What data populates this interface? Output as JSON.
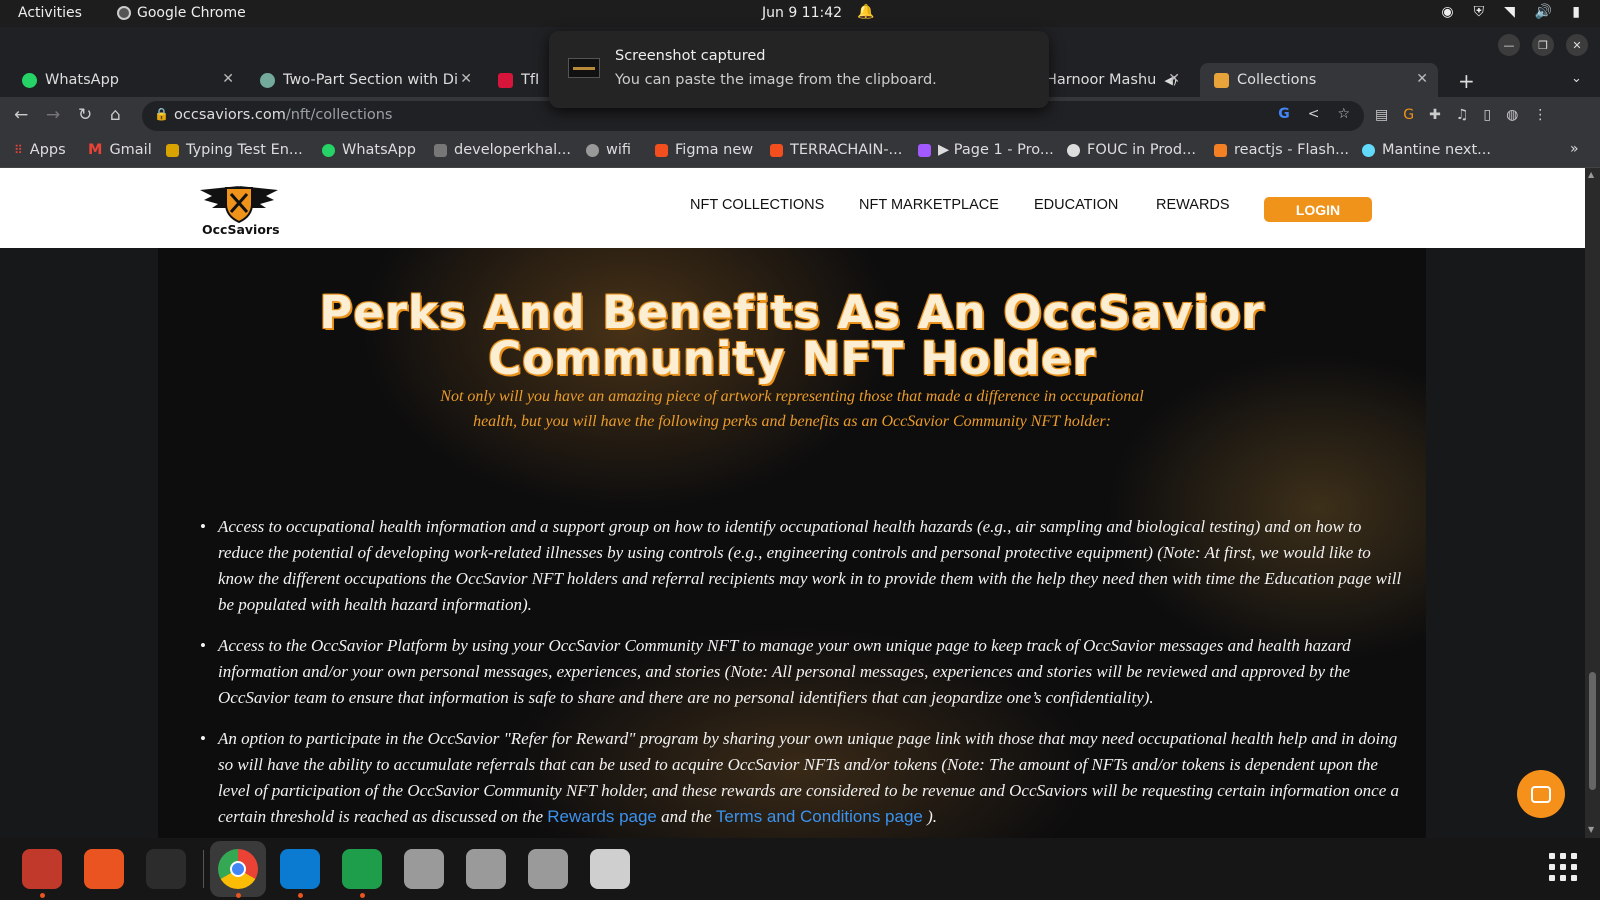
{
  "system_bar": {
    "activities": "Activities",
    "app_name": "Google Chrome",
    "datetime": "Jun 9  11:42"
  },
  "notification": {
    "title": "Screenshot captured",
    "body": "You can paste the image from the clipboard."
  },
  "tabs": [
    {
      "label": "WhatsApp",
      "icon": "whatsapp-icon",
      "color": "#25d366"
    },
    {
      "label": "Two-Part Section with Div",
      "icon": "chatgpt-icon",
      "color": "#74aa9c"
    },
    {
      "label": "TfN",
      "icon": "nsw-icon",
      "color": "#d7153a"
    },
    {
      "label": "Harnoor Mashu",
      "icon": "audio-icon",
      "color": "#888888"
    },
    {
      "label": "Collections",
      "icon": "occsaviors-icon",
      "color": "#e8a33a"
    }
  ],
  "address_bar": {
    "domain": "occsaviors.com",
    "path": "/nft/collections"
  },
  "bookmarks": [
    {
      "label": "Apps",
      "color": "#ea4335"
    },
    {
      "label": "Gmail",
      "color": "#ea4335"
    },
    {
      "label": "Typing Test En...",
      "color": "#d9a400"
    },
    {
      "label": "WhatsApp",
      "color": "#25d366"
    },
    {
      "label": "developerkhal...",
      "color": "#777777"
    },
    {
      "label": "wifi",
      "color": "#999999"
    },
    {
      "label": "Figma new",
      "color": "#f24e1e"
    },
    {
      "label": "TERRACHAIN-...",
      "color": "#f24e1e"
    },
    {
      "label": "▶ Page 1 - Pro...",
      "color": "#a259ff"
    },
    {
      "label": "FOUC in Prod...",
      "color": "#dddddd"
    },
    {
      "label": "reactjs - Flash...",
      "color": "#f48024"
    },
    {
      "label": "Mantine next...",
      "color": "#61dafb"
    }
  ],
  "site": {
    "logo_text": "OccSaviors",
    "nav": [
      "NFT COLLECTIONS",
      "NFT MARKETPLACE",
      "EDUCATION",
      "REWARDS"
    ],
    "login": "LOGIN",
    "headline_line1": "Perks And Benefits As An OccSavior",
    "headline_line2": "Community NFT Holder",
    "subhead": "Not only will you have an amazing piece of artwork representing those that made a difference in occupational health, but you will have the following perks and benefits as an OccSavior Community NFT holder:",
    "perks": [
      "Access to occupational health information and a support group on how to identify occupational health hazards (e.g., air sampling and biological testing) and on how to reduce the potential of developing work-related illnesses by using controls (e.g., engineering controls and personal protective equipment) (Note: At first, we would like to know the different occupations the OccSavior NFT holders and referral recipients may work in to provide them with the help they need then with time the Education page will be populated with health hazard information).",
      "Access to the OccSavior Platform by using your OccSavior Community NFT to manage your own unique page to keep track of OccSavior messages and health hazard information and/or your own personal messages, experiences, and stories (Note: All personal messages, experiences and stories will be reviewed and approved by the OccSavior team to ensure that information is safe to share and there are no personal identifiers that can jeopardize one’s confidentiality)."
    ],
    "perk3_text": "An option to participate in the OccSavior \"Refer for Reward\" program by sharing your own unique page link with those that may need occupational health help and in doing so will have the ability to accumulate referrals that can be used to acquire OccSavior NFTs and/or tokens (Note: The amount of NFTs and/or tokens is dependent upon the level of participation of the OccSavior Community NFT holder, and these rewards are considered to be revenue and OccSaviors will be requesting certain information once a certain threshold is reached as discussed on the ",
    "perk3_link1": "Rewards page",
    "perk3_mid": " and the ",
    "perk3_link2": "Terms and Conditions page",
    "perk3_end": " )."
  },
  "dock": [
    {
      "name": "files-icon",
      "color": "#c0392b",
      "running": true
    },
    {
      "name": "software-icon",
      "color": "#e95420",
      "running": false
    },
    {
      "name": "terminal-icon",
      "color": "#2c2c2c",
      "running": false
    },
    {
      "name": "chrome-icon",
      "color": "#4285f4",
      "running": true
    },
    {
      "name": "vscode-icon",
      "color": "#0a7bd1",
      "running": true
    },
    {
      "name": "spreadsheet-icon",
      "color": "#1e9d4a",
      "running": true
    },
    {
      "name": "disk-icon-1",
      "color": "#9a9a9a",
      "running": false
    },
    {
      "name": "disk-icon-2",
      "color": "#9a9a9a",
      "running": false
    },
    {
      "name": "disk-icon-3",
      "color": "#9a9a9a",
      "running": false
    },
    {
      "name": "trash-icon",
      "color": "#cfcfcf",
      "running": false
    }
  ],
  "colors": {
    "accent_orange": "#f0931a",
    "link_blue": "#3b93ef"
  }
}
